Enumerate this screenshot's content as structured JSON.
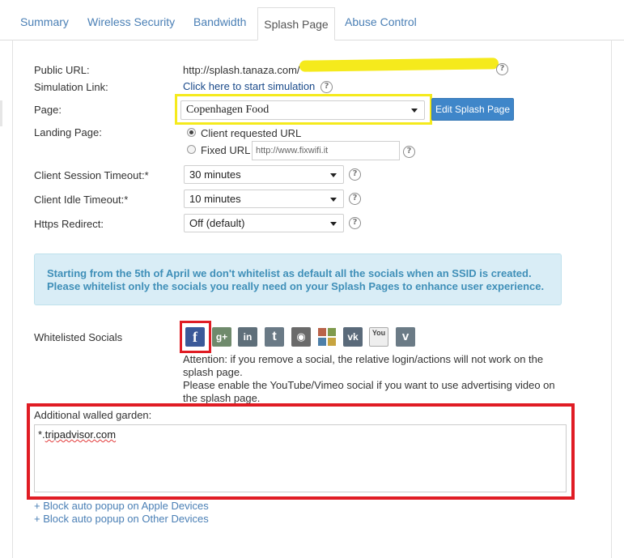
{
  "tabs": [
    {
      "label": "Summary"
    },
    {
      "label": "Wireless Security"
    },
    {
      "label": "Bandwidth"
    },
    {
      "label": "Splash Page"
    },
    {
      "label": "Abuse Control"
    }
  ],
  "public_url": {
    "label": "Public URL:",
    "value": "http://splash.tanaza.com/"
  },
  "simulation": {
    "label": "Simulation Link:",
    "link": "Click here to start simulation"
  },
  "page": {
    "label": "Page:",
    "selected": "Copenhagen Food",
    "edit_button": "Edit Splash Page"
  },
  "landing": {
    "label": "Landing Page:",
    "option_client": "Client requested URL",
    "option_fixed": "Fixed URL",
    "fixed_url_value": "http://www.fixwifi.it"
  },
  "session_timeout": {
    "label": "Client Session Timeout:*",
    "selected": "30 minutes"
  },
  "idle_timeout": {
    "label": "Client Idle Timeout:*",
    "selected": "10 minutes"
  },
  "https_redirect": {
    "label": "Https Redirect:",
    "selected": "Off (default)"
  },
  "alert": {
    "line1": "Starting from the 5th of April we don't whitelist as default all the socials when an SSID is created.",
    "line2": "Please whitelist only the socials you really need on your Splash Pages to enhance user experience."
  },
  "socials": {
    "label": "Whitelisted Socials",
    "icons": [
      {
        "name": "facebook-icon",
        "glyph": "f",
        "color": "#3b5998"
      },
      {
        "name": "google-plus-icon",
        "glyph": "g+",
        "color": "#6f8a6c"
      },
      {
        "name": "linkedin-icon",
        "glyph": "in",
        "color": "#5f6f7a"
      },
      {
        "name": "twitter-icon",
        "glyph": "t",
        "color": "#6a7a86"
      },
      {
        "name": "instagram-icon",
        "glyph": "◉",
        "color": "#6a6a6a"
      },
      {
        "name": "microsoft-icon",
        "glyph": "",
        "color": "#888888"
      },
      {
        "name": "vk-icon",
        "glyph": "vk",
        "color": "#5a6a7a"
      },
      {
        "name": "youtube-icon",
        "glyph": "You",
        "color": "#eeeeee"
      },
      {
        "name": "vimeo-icon",
        "glyph": "v",
        "color": "#6b7b86"
      }
    ],
    "note1": "Attention: if you remove a social, the relative login/actions will not work on the",
    "note2": "splash page.",
    "note3": "Please enable the YouTube/Vimeo social if you want to use advertising video on",
    "note4": "the splash page."
  },
  "walled_garden": {
    "label": "Additional walled garden:",
    "prefix": "*.",
    "value": "tripadvisor.com"
  },
  "links": {
    "apple": "+ Block auto popup on Apple Devices",
    "other": "+ Block auto popup on Other Devices"
  },
  "help_glyph": "?",
  "colors": {
    "accent": "#3f86c9",
    "highlight_yellow": "#f5ea1c",
    "highlight_red": "#e01c24"
  }
}
